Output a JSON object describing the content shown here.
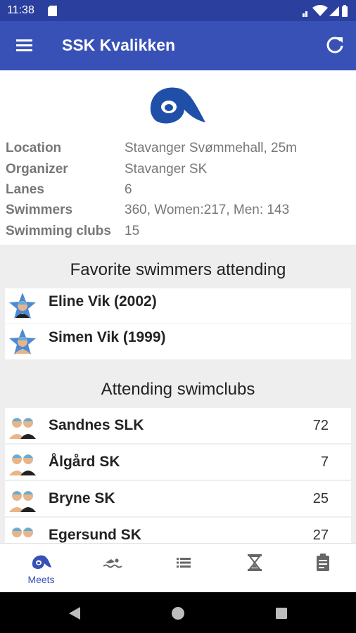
{
  "status_bar": {
    "time": "11:38"
  },
  "app_bar": {
    "title": "SSK Kvalikken"
  },
  "meet_info": [
    {
      "label": "Location",
      "value": "Stavanger Svømmehall, 25m"
    },
    {
      "label": "Organizer",
      "value": "Stavanger SK"
    },
    {
      "label": "Lanes",
      "value": "6"
    },
    {
      "label": "Swimmers",
      "value": "360, Women:217, Men: 143"
    },
    {
      "label": "Swimming clubs",
      "value": "15"
    }
  ],
  "favorites": {
    "heading": "Favorite swimmers attending",
    "items": [
      {
        "name": "Eline Vik (2002)",
        "icon": "female-swimmer-star-icon"
      },
      {
        "name": "Simen Vik (1999)",
        "icon": "male-swimmer-star-icon"
      }
    ]
  },
  "clubs": {
    "heading": "Attending swimclubs",
    "items": [
      {
        "name": "Sandnes SLK",
        "count": "72"
      },
      {
        "name": "Ålgård SK",
        "count": "7"
      },
      {
        "name": "Bryne SK",
        "count": "25"
      },
      {
        "name": "Egersund SK",
        "count": "27"
      }
    ]
  },
  "bottom_nav": [
    {
      "label": "Meets",
      "icon": "meets-wave-icon",
      "active": true
    },
    {
      "label": "",
      "icon": "swimmer-icon",
      "active": false
    },
    {
      "label": "",
      "icon": "list-icon",
      "active": false
    },
    {
      "label": "",
      "icon": "hourglass-icon",
      "active": false
    },
    {
      "label": "",
      "icon": "clipboard-icon",
      "active": false
    }
  ],
  "colors": {
    "status_bar": "#2b3f9e",
    "app_bar": "#3851b7",
    "accent": "#3851b7",
    "logo_blue": "#1f4fa8"
  }
}
